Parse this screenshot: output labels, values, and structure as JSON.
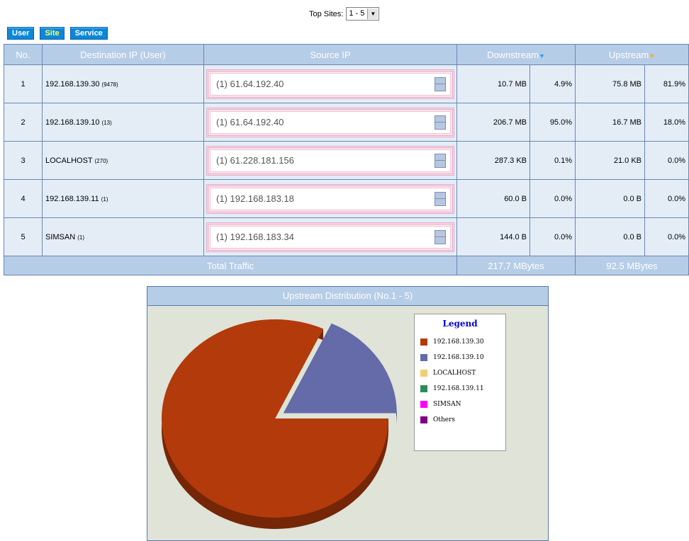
{
  "top_sites": {
    "label": "Top Sites:",
    "selected": "1 - 5"
  },
  "tabs": [
    {
      "label": "User"
    },
    {
      "label": "Site"
    },
    {
      "label": "Service"
    }
  ],
  "table": {
    "headers": {
      "no": "No.",
      "dest": "Destination IP (User)",
      "source": "Source IP",
      "downstream": "Downstream",
      "upstream": "Upstream"
    },
    "rows": [
      {
        "no": "1",
        "dest": "192.168.139.30",
        "count": "(9478)",
        "source": "(1) 61.64.192.40",
        "down": "10.7 MB",
        "down_pct": "4.9%",
        "up": "75.8 MB",
        "up_pct": "81.9%"
      },
      {
        "no": "2",
        "dest": "192.168.139.10",
        "count": "(13)",
        "source": "(1) 61.64.192.40",
        "down": "206.7 MB",
        "down_pct": "95.0%",
        "up": "16.7 MB",
        "up_pct": "18.0%"
      },
      {
        "no": "3",
        "dest": "LOCALHOST",
        "count": "(270)",
        "source": "(1) 61.228.181.156",
        "down": "287.3 KB",
        "down_pct": "0.1%",
        "up": "21.0 KB",
        "up_pct": "0.0%"
      },
      {
        "no": "4",
        "dest": "192.168.139.11",
        "count": "(1)",
        "source": "(1) 192.168.183.18",
        "down": "60.0 B",
        "down_pct": "0.0%",
        "up": "0.0 B",
        "up_pct": "0.0%"
      },
      {
        "no": "5",
        "dest": "SIMSAN",
        "count": "(1)",
        "source": "(1) 192.168.183.34",
        "down": "144.0 B",
        "down_pct": "0.0%",
        "up": "0.0 B",
        "up_pct": "0.0%"
      }
    ],
    "total": {
      "label": "Total Traffic",
      "down": "217.7 MBytes",
      "up": "92.5 MBytes"
    }
  },
  "chart_data": {
    "type": "pie",
    "title": "Upstream Distribution (No.1 - 5)",
    "legend_title": "Legend",
    "legend_position": "right",
    "labels": [
      "192.168.139.30",
      "192.168.139.10",
      "LOCALHOST",
      "192.168.139.11",
      "SIMSAN",
      "Others"
    ],
    "values": [
      81.9,
      18.0,
      0.0,
      0.0,
      0.0,
      0.0
    ],
    "colors": [
      "#b33a0b",
      "#646ba8",
      "#f0d070",
      "#2e8b57",
      "#ff00ff",
      "#800080"
    ],
    "exploded": "192.168.139.10"
  }
}
